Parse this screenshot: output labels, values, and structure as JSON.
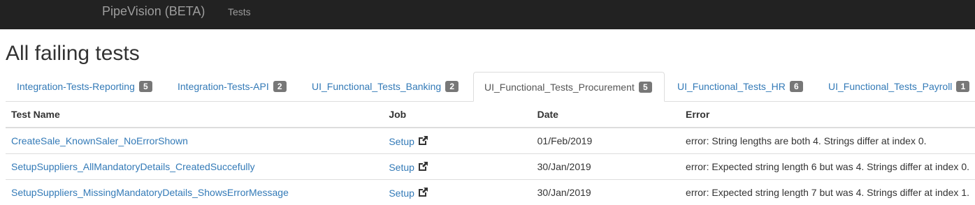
{
  "navbar": {
    "brand": "PipeVision (BETA)",
    "links": [
      "Tests"
    ],
    "background": "#222222"
  },
  "page": {
    "title": "All failing tests"
  },
  "tabs": [
    {
      "label": "Integration-Tests-Reporting",
      "count": "5",
      "active": false
    },
    {
      "label": "Integration-Tests-API",
      "count": "2",
      "active": false
    },
    {
      "label": "UI_Functional_Tests_Banking",
      "count": "2",
      "active": false
    },
    {
      "label": "UI_Functional_Tests_Procurement",
      "count": "5",
      "active": true
    },
    {
      "label": "UI_Functional_Tests_HR",
      "count": "6",
      "active": false
    },
    {
      "label": "UI_Functional_Tests_Payroll",
      "count": "1",
      "active": false
    }
  ],
  "table": {
    "headers": [
      "Test Name",
      "Job",
      "Date",
      "Error"
    ],
    "rows": [
      {
        "test_name": "CreateSale_KnownSaler_NoErrorShown",
        "job": "Setup",
        "job_icon": "external-link-icon",
        "date": "01/Feb/2019",
        "error": "error: String lengths are both 4. Strings differ at index 0."
      },
      {
        "test_name": "SetupSuppliers_AllMandatoryDetails_CreatedSuccefully",
        "job": "Setup",
        "job_icon": "external-link-icon",
        "date": "30/Jan/2019",
        "error": "error: Expected string length 6 but was 4. Strings differ at index 0."
      },
      {
        "test_name": "SetupSuppliers_MissingMandatoryDetails_ShowsErrorMessage",
        "job": "Setup",
        "job_icon": "external-link-icon",
        "date": "30/Jan/2019",
        "error": "error: Expected string length 7 but was 4. Strings differ at index 1."
      }
    ]
  },
  "colors": {
    "link": "#337ab7",
    "badge": "#777777",
    "border": "#dddddd"
  }
}
